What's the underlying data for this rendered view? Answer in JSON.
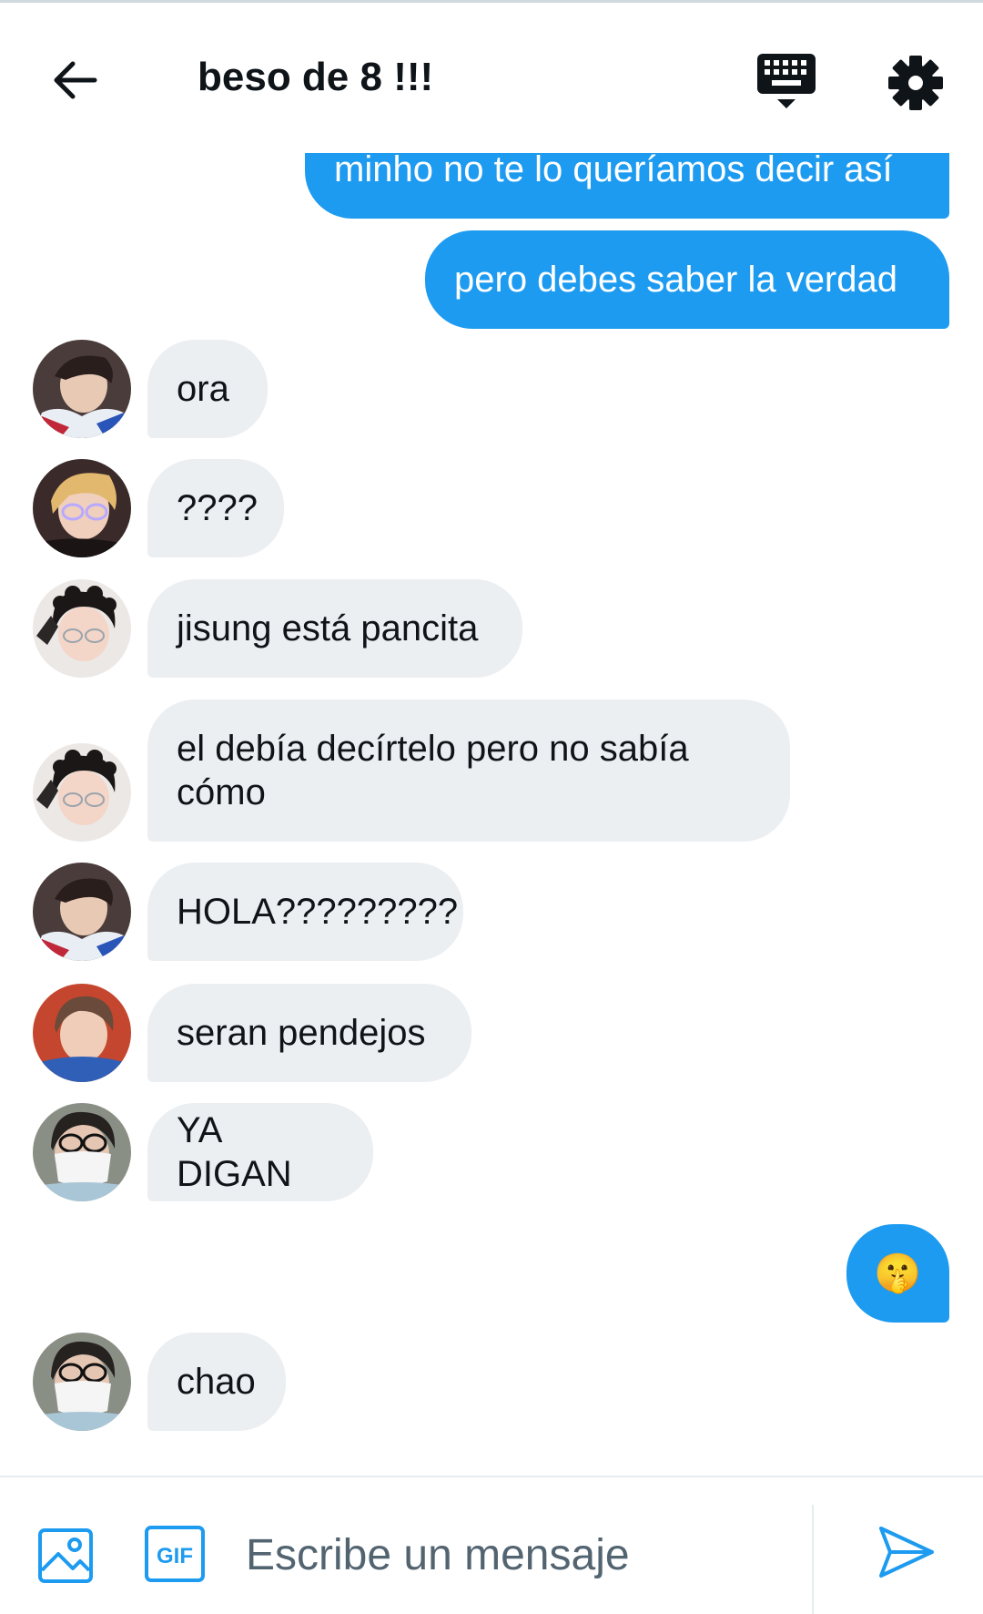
{
  "header": {
    "title": "beso de 8 !!!",
    "icons": [
      "back-arrow-icon",
      "keyboard-icon",
      "gear-icon"
    ]
  },
  "colors": {
    "accent": "#1d9bf0",
    "received_bubble": "#eceff2",
    "text": "#0f1419",
    "placeholder": "#536471"
  },
  "messages": [
    {
      "from": "me",
      "text": "minho no te lo queríamos decir así"
    },
    {
      "from": "me",
      "text": "pero debes saber la verdad"
    },
    {
      "from": "other",
      "text": "ora"
    },
    {
      "from": "other",
      "text": "????"
    },
    {
      "from": "other",
      "text": "jisung está pancita"
    },
    {
      "from": "other",
      "text": "el debía decírtelo pero no sabía cómo"
    },
    {
      "from": "other",
      "text": "HOLA?????????"
    },
    {
      "from": "other",
      "text": "seran pendejos"
    },
    {
      "from": "other",
      "text": "YA DIGAN"
    },
    {
      "from": "me",
      "text": "🤫"
    },
    {
      "from": "other",
      "text": "chao"
    }
  ],
  "composer": {
    "placeholder": "Escribe un mensaje",
    "icons": [
      "image-icon",
      "gif-icon",
      "send-icon"
    ]
  }
}
